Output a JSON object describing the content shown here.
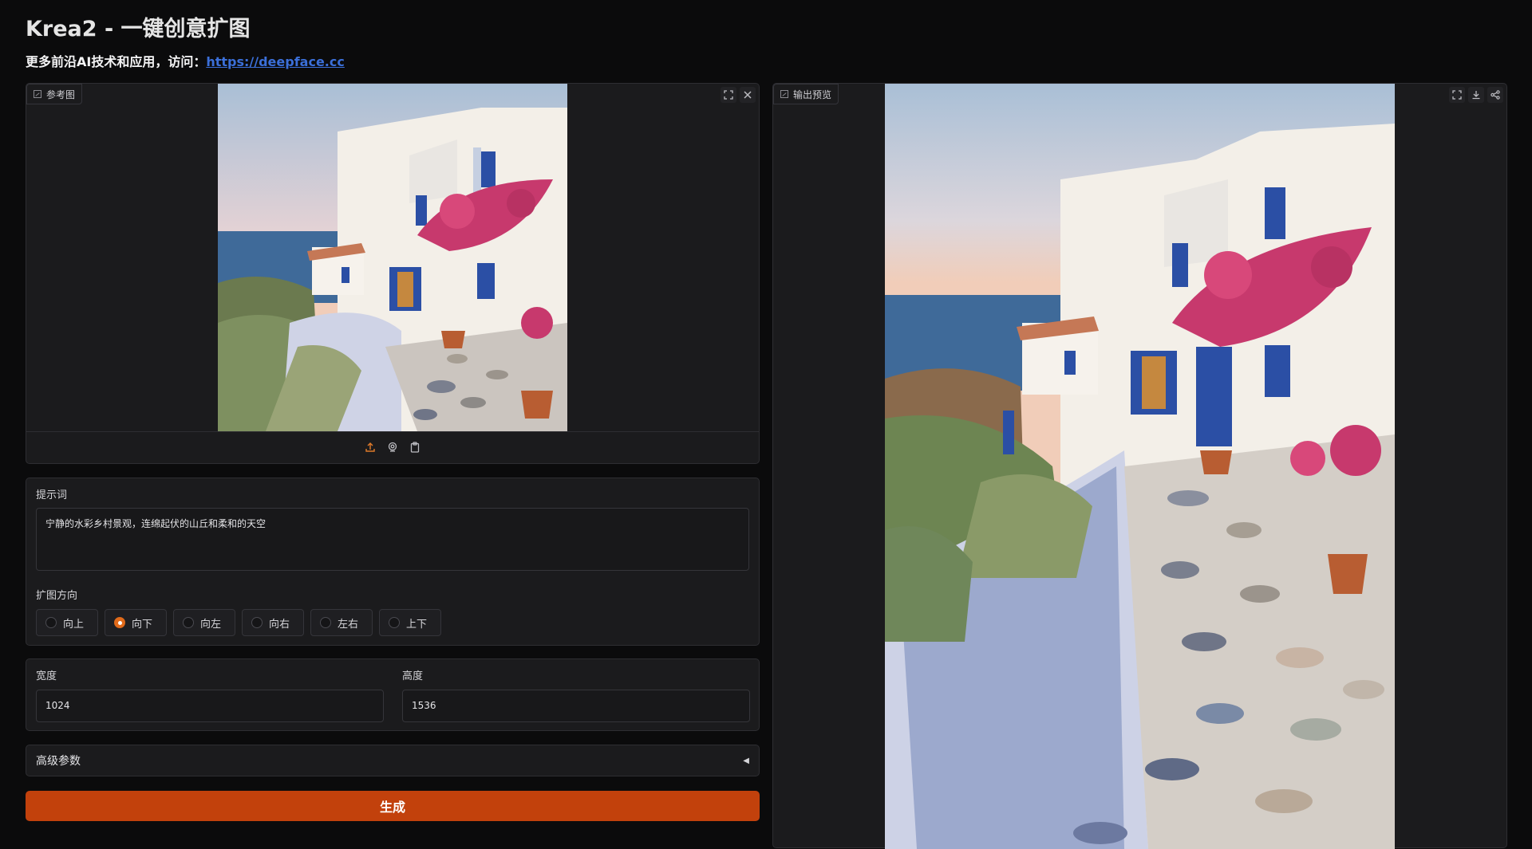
{
  "header": {
    "title": "Krea2 - 一键创意扩图",
    "subtitle_prefix": "更多前沿AI技术和应用，访问：",
    "subtitle_link": "https://deepface.cc"
  },
  "reference_panel": {
    "label": "参考图",
    "icons": [
      "fullscreen-icon",
      "close-icon",
      "upload-icon",
      "webcam-icon",
      "clipboard-icon"
    ]
  },
  "output_panel": {
    "label": "输出预览",
    "icons": [
      "fullscreen-icon",
      "download-icon",
      "share-icon"
    ]
  },
  "prompt": {
    "label": "提示词",
    "value": "宁静的水彩乡村景观，连绵起伏的山丘和柔和的天空"
  },
  "direction": {
    "label": "扩图方向",
    "options": [
      {
        "label": "向上",
        "checked": false
      },
      {
        "label": "向下",
        "checked": true
      },
      {
        "label": "向左",
        "checked": false
      },
      {
        "label": "向右",
        "checked": false
      },
      {
        "label": "左右",
        "checked": false
      },
      {
        "label": "上下",
        "checked": false
      }
    ]
  },
  "size": {
    "width_label": "宽度",
    "width_value": "1024",
    "height_label": "高度",
    "height_value": "1536"
  },
  "advanced": {
    "label": "高级参数"
  },
  "generate": {
    "label": "生成"
  },
  "colors": {
    "accent": "#c2410c",
    "radio_checked": "#e06a1a",
    "link": "#3b6fd8",
    "background": "#0b0b0c",
    "panel": "#1b1b1d"
  }
}
